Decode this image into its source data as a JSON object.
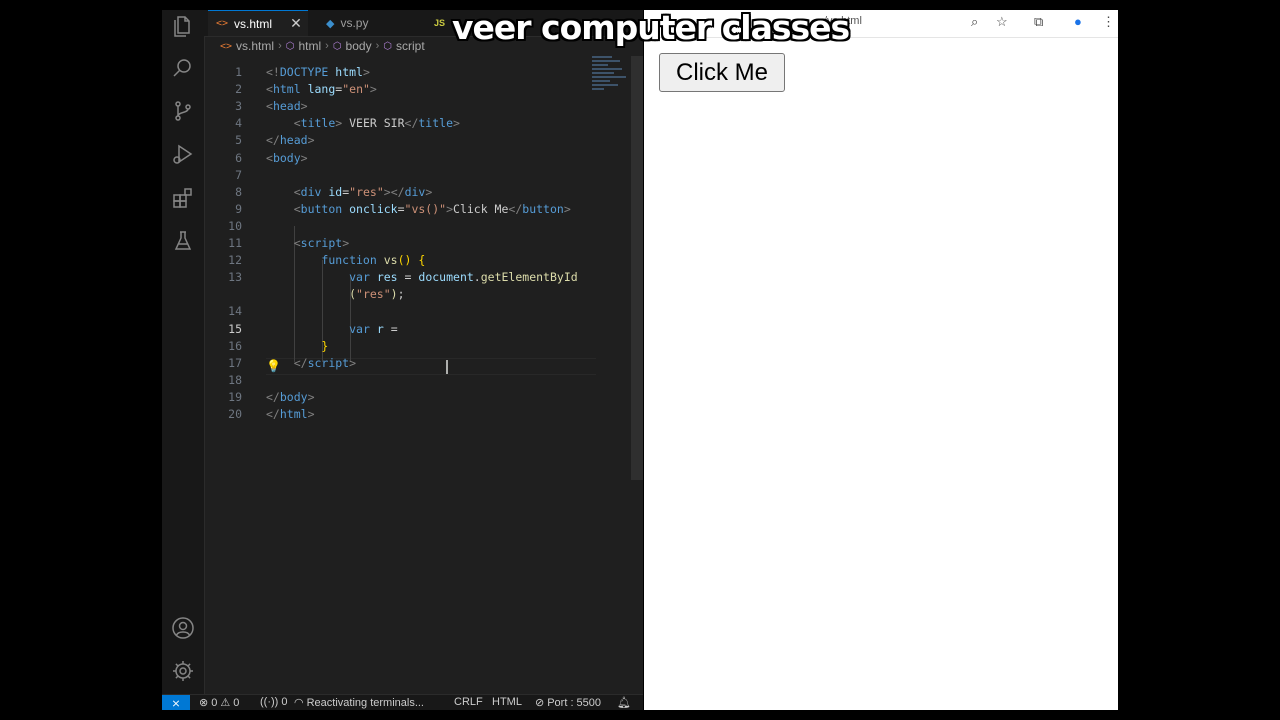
{
  "editor_window": {
    "tabs": [
      {
        "label": "vs.html",
        "icon": "html-file-icon",
        "active": true
      },
      {
        "label": "vs.py",
        "icon": "python-file-icon",
        "active": false
      },
      {
        "label": "JS",
        "icon": "js-file-icon",
        "active": false
      }
    ],
    "breadcrumb": [
      "vs.html",
      "html",
      "body",
      "script"
    ],
    "code_lines": [
      {
        "n": "1",
        "html": "<span class='t-tag'>&lt;!</span><span class='t-doc'>DOCTYPE</span> <span class='t-attr'>html</span><span class='t-tag'>&gt;</span>"
      },
      {
        "n": "2",
        "html": "<span class='t-tag'>&lt;</span><span class='t-name'>html</span> <span class='t-attr'>lang</span><span class='t-txt'>=</span><span class='t-str'>\"en\"</span><span class='t-tag'>&gt;</span>"
      },
      {
        "n": "3",
        "html": "<span class='t-tag'>&lt;</span><span class='t-name'>head</span><span class='t-tag'>&gt;</span>"
      },
      {
        "n": "4",
        "html": "    <span class='t-tag'>&lt;</span><span class='t-name'>title</span><span class='t-tag'>&gt;</span><span class='t-txt'> VEER SIR</span><span class='t-tag'>&lt;/</span><span class='t-name'>title</span><span class='t-tag'>&gt;</span>"
      },
      {
        "n": "5",
        "html": "<span class='t-tag'>&lt;/</span><span class='t-name'>head</span><span class='t-tag'>&gt;</span>"
      },
      {
        "n": "6",
        "html": "<span class='t-tag'>&lt;</span><span class='t-name'>body</span><span class='t-tag'>&gt;</span>"
      },
      {
        "n": "7",
        "html": ""
      },
      {
        "n": "8",
        "html": "    <span class='t-tag'>&lt;</span><span class='t-name'>div</span> <span class='t-attr'>id</span><span class='t-txt'>=</span><span class='t-str'>\"res\"</span><span class='t-tag'>&gt;&lt;/</span><span class='t-name'>div</span><span class='t-tag'>&gt;</span>"
      },
      {
        "n": "9",
        "html": "    <span class='t-tag'>&lt;</span><span class='t-name'>button</span> <span class='t-attr'>onclick</span><span class='t-txt'>=</span><span class='t-str'>\"vs()\"</span><span class='t-tag'>&gt;</span><span class='t-txt'>Click Me</span><span class='t-tag'>&lt;/</span><span class='t-name'>button</span><span class='t-tag'>&gt;</span>"
      },
      {
        "n": "10",
        "html": ""
      },
      {
        "n": "11",
        "html": "    <span class='t-tag'>&lt;</span><span class='t-name'>script</span><span class='t-tag'>&gt;</span>"
      },
      {
        "n": "12",
        "html": "        <span class='t-kw'>function</span> <span class='t-fn'>vs</span><span class='t-br'>() {</span>"
      },
      {
        "n": "13",
        "html": "            <span class='t-kw'>var</span> <span class='t-var'>res</span> <span class='t-txt'>=</span> <span class='t-var'>document</span><span class='t-txt'>.</span><span class='t-fn'>getElementById</span>"
      },
      {
        "n": "",
        "html": "            <span class='t-fn'>(</span><span class='t-str'>\"res\"</span><span class='t-fn'>)</span><span class='t-txt'>;</span>"
      },
      {
        "n": "14",
        "html": ""
      },
      {
        "n": "15",
        "html": "            <span class='t-kw'>var</span> <span class='t-var'>r</span> <span class='t-txt'>=</span> "
      },
      {
        "n": "16",
        "html": "        <span class='t-br'>}</span>"
      },
      {
        "n": "17",
        "html": "    <span class='t-tag'>&lt;/</span><span class='t-name'>script</span><span class='t-tag'>&gt;</span>"
      },
      {
        "n": "18",
        "html": ""
      },
      {
        "n": "19",
        "html": "<span class='t-tag'>&lt;/</span><span class='t-name'>body</span><span class='t-tag'>&gt;</span>"
      },
      {
        "n": "20",
        "html": "<span class='t-tag'>&lt;/</span><span class='t-name'>html</span><span class='t-tag'>&gt;</span>"
      }
    ],
    "active_line": "15",
    "status_bar": {
      "errors": "0",
      "warnings": "0",
      "ports": "0",
      "message": "Reactivating terminals...",
      "eol": "CRLF",
      "language": "HTML",
      "port": "Port : 5500"
    }
  },
  "browser": {
    "address": "/vs.html",
    "button_label": "Click Me"
  },
  "watermark": "veer computer classes",
  "colors": {
    "editor_bg": "#1f1f1f",
    "accent": "#0078d4",
    "tag_name": "#569cd6",
    "string": "#ce9178"
  }
}
